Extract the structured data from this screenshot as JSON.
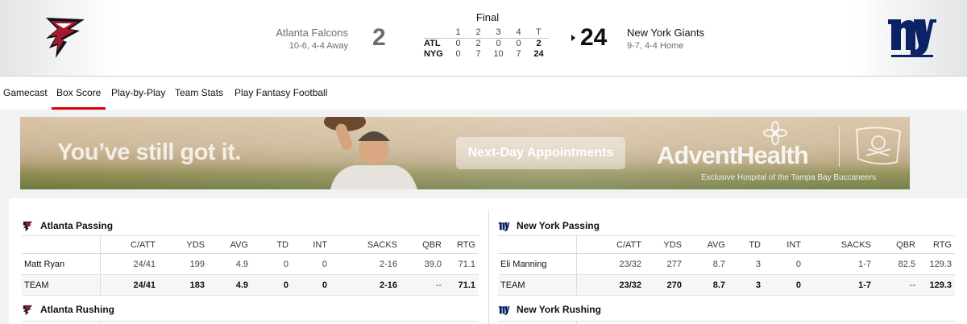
{
  "game": {
    "status": "Final",
    "away": {
      "name": "Atlanta Falcons",
      "record": "10-6, 4-4 Away",
      "abbr": "ATL",
      "score": "2",
      "quarters": [
        "0",
        "2",
        "0",
        "0"
      ],
      "total": "2",
      "color": "#a71930"
    },
    "home": {
      "name": "New York Giants",
      "record": "9-7, 4-4 Home",
      "abbr": "NYG",
      "score": "24",
      "quarters": [
        "0",
        "7",
        "10",
        "7"
      ],
      "total": "24",
      "color": "#0b2265"
    },
    "linescore_headers": [
      "1",
      "2",
      "3",
      "4",
      "T"
    ],
    "logo_icons": [
      "falcons-logo-icon",
      "giants-logo-icon"
    ]
  },
  "tabs": [
    {
      "label": "Gamecast",
      "active": false
    },
    {
      "label": "Box Score",
      "active": true
    },
    {
      "label": "Play-by-Play",
      "active": false
    },
    {
      "label": "Team Stats",
      "active": false
    },
    {
      "label": "Play Fantasy Football",
      "active": false
    }
  ],
  "ad": {
    "headline": "You’ve still got it.",
    "cta": "Next-Day Appointments",
    "brand": "AdventHealth",
    "tagline": "Exclusive Hospital of the Tampa Bay Buccaneers"
  },
  "passing": {
    "columns": [
      "C/ATT",
      "YDS",
      "AVG",
      "TD",
      "INT",
      "SACKS",
      "QBR",
      "RTG"
    ],
    "away": {
      "title": "Atlanta Passing",
      "rows": [
        {
          "name": "Matt Ryan",
          "cells": [
            "24/41",
            "199",
            "4.9",
            "0",
            "0",
            "2-16",
            "39.0",
            "71.1"
          ]
        },
        {
          "name": "TEAM",
          "cells": [
            "24/41",
            "183",
            "4.9",
            "0",
            "0",
            "2-16",
            "--",
            "71.1"
          ]
        }
      ]
    },
    "home": {
      "title": "New York Passing",
      "rows": [
        {
          "name": "Eli Manning",
          "cells": [
            "23/32",
            "277",
            "8.7",
            "3",
            "0",
            "1-7",
            "82.5",
            "129.3"
          ]
        },
        {
          "name": "TEAM",
          "cells": [
            "23/32",
            "270",
            "8.7",
            "3",
            "0",
            "1-7",
            "--",
            "129.3"
          ]
        }
      ]
    }
  },
  "rushing": {
    "away_title": "Atlanta Rushing",
    "home_title": "New York Rushing"
  },
  "colors": {
    "accent_red": "#dd0000",
    "falcons_red": "#a71930",
    "giants_blue": "#0b2265"
  }
}
